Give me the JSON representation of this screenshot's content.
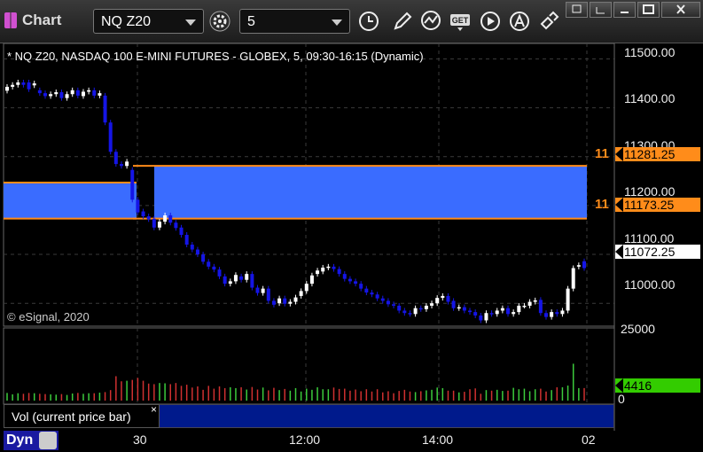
{
  "window": {
    "title": "Chart"
  },
  "toolbar": {
    "symbol": "NQ Z20",
    "interval": "5",
    "icons": [
      "settings-icon",
      "clock-icon",
      "pencil-icon",
      "line-study-icon",
      "get-icon",
      "play-icon",
      "alert-icon",
      "link-icon"
    ],
    "window_buttons": [
      "restore-down-icon",
      "minimize-icon",
      "maximize-icon",
      "close-icon"
    ]
  },
  "chart_info": "* NQ Z20, NASDAQ 100 E-MINI FUTURES - GLOBEX, 5, 09:30-16:15 (Dynamic)",
  "copyright": "© eSignal, 2020",
  "price_axis": [
    "11500.00",
    "11400.00",
    "11300.00",
    "11200.00",
    "11100.00",
    "11000.00"
  ],
  "price_tags": {
    "upper": "11281.25",
    "lower": "11173.25",
    "last": "11072.25",
    "upper_prefix": "11",
    "lower_prefix": "11"
  },
  "volume_axis": {
    "top": "25000",
    "bottom": "0",
    "current": "4416"
  },
  "time_axis": [
    "30",
    "12:00",
    "14:00",
    "02"
  ],
  "volume_label": "Vol (current price bar)",
  "volume_close": "×",
  "bottom_left": "Dyn",
  "colors": {
    "bull": "#ffffff",
    "bear": "#1515e6",
    "zone": "#3a6cff",
    "order_line": "#ff8c1a",
    "vol_up": "#3ccc3c",
    "vol_down": "#d03030",
    "vol_current": "#33cc00"
  },
  "chart_data": {
    "type": "candlestick",
    "price_ylim": [
      10955,
      11530
    ],
    "open": [
      11435,
      11443,
      11447,
      11452,
      11452,
      11446,
      11436,
      11430,
      11424,
      11428,
      11432,
      11420,
      11428,
      11436,
      11424,
      11433,
      11436,
      11425,
      11425,
      11370,
      11310,
      11285,
      11281,
      11273,
      11212,
      11188,
      11178,
      11173,
      11155,
      11167,
      11180,
      11165,
      11155,
      11140,
      11120,
      11110,
      11100,
      11085,
      11075,
      11069,
      11055,
      11040,
      11045,
      11055,
      11048,
      11060,
      11032,
      11021,
      11030,
      11005,
      11000,
      11010,
      10999,
      11003,
      11015,
      11025,
      11040,
      11060,
      11065,
      11073,
      11075,
      11070,
      11060,
      11050,
      11045,
      11040,
      11030,
      11022,
      11018,
      11010,
      11005,
      10998,
      10995,
      10985,
      10980,
      10978,
      10990,
      10988,
      10995,
      11000,
      11011,
      11015,
      11005,
      10990,
      10992,
      10985,
      10982,
      10975,
      10965,
      10980,
      10978,
      10985,
      10990,
      10978,
      10982,
      10995,
      10995,
      11003,
      11007,
      10980,
      10972,
      10982,
      10978,
      10985,
      11030,
      11075,
      11086
    ],
    "close": [
      11443,
      11447,
      11452,
      11447,
      11438,
      11450,
      11430,
      11424,
      11428,
      11432,
      11420,
      11428,
      11436,
      11425,
      11433,
      11436,
      11425,
      11430,
      11370,
      11310,
      11285,
      11281,
      11290,
      11212,
      11186,
      11178,
      11172,
      11155,
      11167,
      11180,
      11165,
      11154,
      11140,
      11120,
      11110,
      11100,
      11085,
      11075,
      11069,
      11055,
      11040,
      11045,
      11058,
      11048,
      11060,
      11032,
      11021,
      11030,
      11005,
      10997,
      11010,
      10999,
      11003,
      11012,
      11025,
      11040,
      11057,
      11067,
      11073,
      11075,
      11070,
      11060,
      11050,
      11045,
      11040,
      11030,
      11022,
      11018,
      11010,
      11005,
      10998,
      10995,
      10985,
      10980,
      10978,
      10990,
      10988,
      10995,
      11000,
      11011,
      11015,
      11003,
      10990,
      10992,
      10985,
      10982,
      10975,
      10965,
      10980,
      10978,
      10985,
      10990,
      10978,
      10982,
      10995,
      10995,
      11003,
      11006,
      10980,
      10972,
      10982,
      10978,
      10985,
      11030,
      11072,
      11078,
      11072
    ],
    "upper_zone": [
      11244,
      11281.25
    ],
    "lower_zone": [
      11173.25,
      11247
    ],
    "volume_ylim": [
      0,
      25000
    ],
    "volume": [
      2700,
      2200,
      2600,
      2400,
      2700,
      2600,
      2400,
      2300,
      2200,
      2100,
      2300,
      2000,
      2500,
      2700,
      2400,
      2600,
      2600,
      2800,
      3000,
      3700,
      8600,
      6800,
      7000,
      7300,
      8000,
      7000,
      6000,
      5800,
      6200,
      6100,
      5800,
      6200,
      5200,
      5600,
      4600,
      5000,
      3800,
      5200,
      4200,
      5000,
      4400,
      4700,
      4400,
      4700,
      3900,
      4800,
      3900,
      4600,
      3600,
      4500,
      3700,
      4100,
      3500,
      4400,
      3200,
      4200,
      3800,
      4700,
      4000,
      4000,
      4600,
      4100,
      4200,
      3500,
      3900,
      3300,
      4000,
      3200,
      4000,
      2900,
      3300,
      2600,
      3400,
      3800,
      3200,
      3000,
      3300,
      3600,
      3800,
      4600,
      4400,
      3500,
      3500,
      2900,
      3100,
      4000,
      4300,
      2400,
      3700,
      3500,
      3800,
      3400,
      3500,
      4500,
      4000,
      4200,
      3300,
      4000,
      4200,
      3200,
      3700,
      4700,
      4700,
      5300,
      13000,
      4400,
      4416
    ]
  }
}
